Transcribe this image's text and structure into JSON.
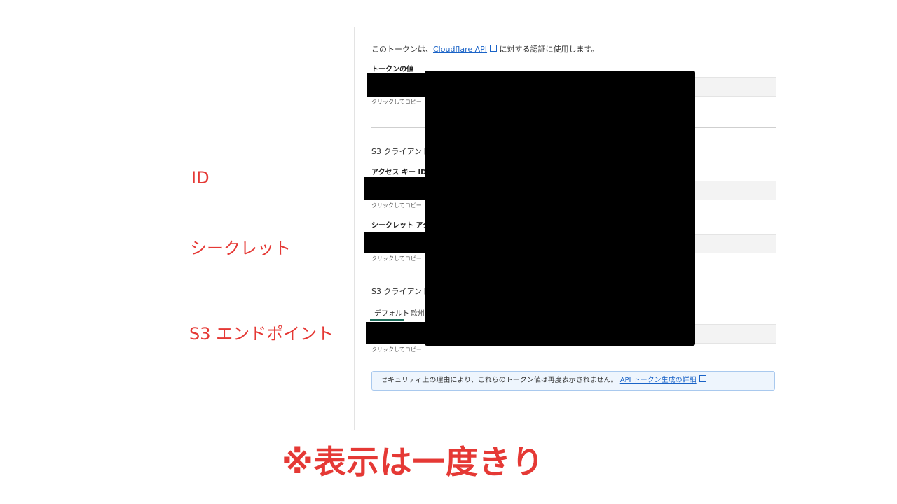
{
  "intro": {
    "prefix": "このトークンは、",
    "link": "Cloudflare API",
    "suffix": " に対する認証に使用します。"
  },
  "token": {
    "label": "トークンの値",
    "hint": "クリックしてコピー"
  },
  "s3_section": {
    "intro": "S3 クライアントに",
    "access_key_label": "アクセス キー ID",
    "access_key_hint": "クリックしてコピー",
    "secret_label": "シークレット アクセス",
    "secret_hint": "クリックしてコピー",
    "endpoint_intro": "S3 クライアントに",
    "endpoint_hint": "クリックしてコピー"
  },
  "endpoint_tabs": [
    "デフォルト",
    "欧州"
  ],
  "notice": {
    "text": "セキュリティ上の理由により、これらのトークン値は再度表示されません。",
    "link": "API トークン生成の詳細"
  },
  "annotations": {
    "id": "ID",
    "secret": "シークレット",
    "endpoint": "S3 エンドポイント",
    "note": "※表示は一度きり"
  },
  "colors": {
    "annotation": "#e53935",
    "link": "#1a63c7",
    "tab_active": "#1f6f5c",
    "notice_bg": "#eef5fd",
    "notice_border": "#a9c9ee"
  },
  "icons": {
    "external_link": "external-link-icon"
  }
}
